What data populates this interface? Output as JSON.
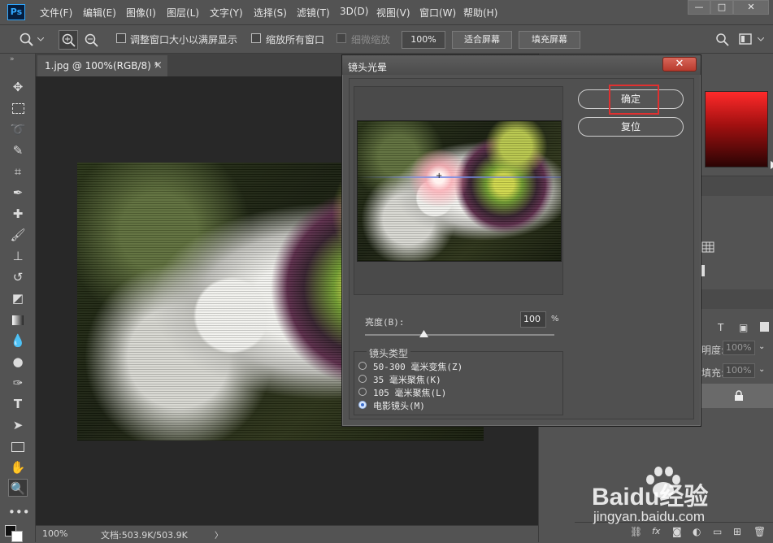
{
  "app": {
    "logo": "Ps"
  },
  "menu": [
    "文件(F)",
    "编辑(E)",
    "图像(I)",
    "图层(L)",
    "文字(Y)",
    "选择(S)",
    "滤镜(T)",
    "3D(D)",
    "视图(V)",
    "窗口(W)",
    "帮助(H)"
  ],
  "window_controls": {
    "minimize": "—",
    "maximize": "□",
    "close": "✕"
  },
  "options": {
    "resize_windows": "调整窗口大小以满屏显示",
    "zoom_all": "缩放所有窗口",
    "scrubby_zoom": "细微缩放",
    "zoom_percent": "100%",
    "fit_screen": "适合屏幕",
    "fill_screen": "填充屏幕"
  },
  "document": {
    "tab_title": "1.jpg @ 100%(RGB/8) *",
    "tab_close": "×",
    "status_zoom": "100%",
    "status_doc": "文档:503.9K/503.9K",
    "status_arrow": "〉"
  },
  "dialog": {
    "title": "镜头光晕",
    "close_symbol": "✕",
    "ok_label": "确定",
    "reset_label": "复位",
    "brightness_label": "亮度(B):",
    "brightness_value": "100",
    "brightness_unit": "%",
    "brightness_slider_fraction": 0.31,
    "lens_type_legend": "镜头类型",
    "lens_options": [
      {
        "label": "50-300 毫米变焦(Z)",
        "selected": false
      },
      {
        "label": "35 毫米聚焦(K)",
        "selected": false
      },
      {
        "label": "105 毫米聚焦(L)",
        "selected": false
      },
      {
        "label": "电影镜头(M)",
        "selected": true
      }
    ]
  },
  "panels": {
    "opacity_label": "明度:",
    "opacity_value": "100%",
    "fill_label": "填充:",
    "fill_value": "100%"
  },
  "watermark": {
    "brand": "Baidu经验",
    "url": "jingyan.baidu.com"
  },
  "colors": {
    "accent_highlight": "#e03030",
    "selected_radio": "#3d6fcf"
  }
}
